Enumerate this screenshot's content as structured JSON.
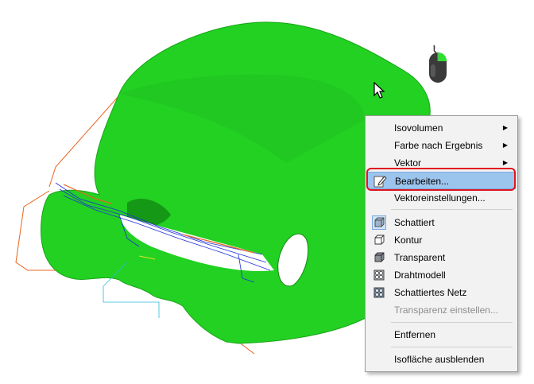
{
  "context_menu": {
    "items": [
      {
        "label": "Isovolumen",
        "submenu": true,
        "enabled": true
      },
      {
        "label": "Farbe nach Ergebnis",
        "submenu": true,
        "enabled": true
      },
      {
        "label": "Vektor",
        "submenu": true,
        "enabled": true
      },
      {
        "label": "Bearbeiten...",
        "icon": "edit-icon",
        "highlighted": true,
        "enabled": true
      },
      {
        "label": "Vektoreinstellungen...",
        "enabled": true
      },
      {
        "label": "Schattiert",
        "icon": "shaded-cube-icon",
        "checked": true,
        "enabled": true
      },
      {
        "label": "Kontur",
        "icon": "contour-cube-icon",
        "enabled": true
      },
      {
        "label": "Transparent",
        "icon": "transparent-cube-icon",
        "enabled": true
      },
      {
        "label": "Drahtmodell",
        "icon": "wireframe-icon",
        "enabled": true
      },
      {
        "label": "Schattiertes Netz",
        "icon": "shaded-mesh-icon",
        "enabled": true
      },
      {
        "label": "Transparenz einstellen...",
        "enabled": false
      },
      {
        "label": "Entfernen",
        "enabled": true
      },
      {
        "label": "Isofläche ausblenden",
        "enabled": true
      }
    ]
  },
  "colors": {
    "isosurface": "#22d122",
    "highlight": "#9cc5ee",
    "callout": "#e0141e"
  }
}
